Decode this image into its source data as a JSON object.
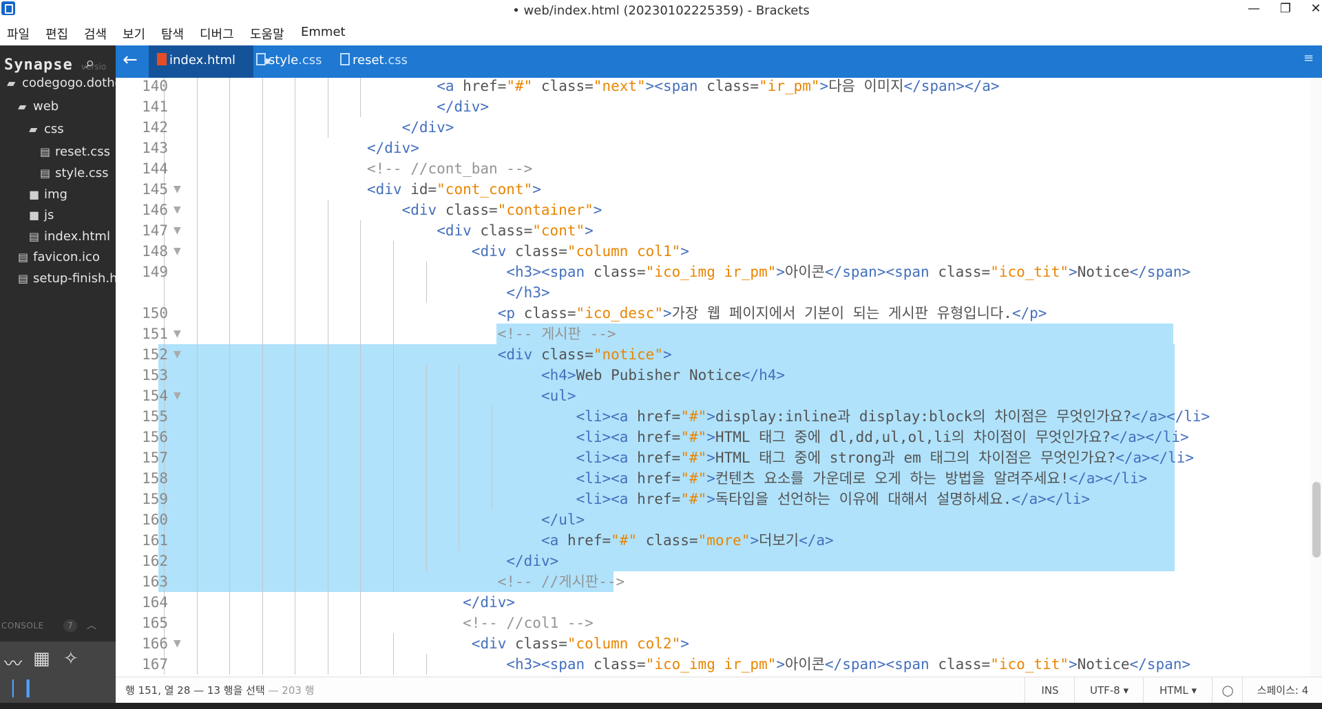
{
  "window": {
    "title": "• web/index.html (20230102225359) - Brackets",
    "controls": {
      "minimize": "—",
      "maximize": "❐",
      "close": "✕"
    }
  },
  "menu": [
    "파일",
    "편집",
    "검색",
    "보기",
    "탐색",
    "디버그",
    "도움말",
    "Emmet"
  ],
  "sidebar": {
    "brand": "Synapse",
    "brand_sub": "versio",
    "search_icon": "search-icon",
    "tree": [
      {
        "label": "codegogo.dotho",
        "type": "folder-open",
        "depth": 0
      },
      {
        "label": "web",
        "type": "folder-open",
        "depth": 1
      },
      {
        "label": "css",
        "type": "folder-open",
        "depth": 2
      },
      {
        "label": "reset.css",
        "type": "file",
        "depth": 3
      },
      {
        "label": "style.css",
        "type": "file",
        "depth": 3
      },
      {
        "label": "img",
        "type": "folder",
        "depth": 2
      },
      {
        "label": "js",
        "type": "folder",
        "depth": 2
      },
      {
        "label": "index.html",
        "type": "file",
        "depth": 2
      },
      {
        "label": "favicon.ico",
        "type": "file",
        "depth": 1
      },
      {
        "label": "setup-finish.h",
        "type": "file",
        "depth": 1
      }
    ],
    "console_label": "CONSOLE",
    "console_count": "7"
  },
  "tabs": [
    {
      "name": "index",
      "ext": ".html",
      "icon": "html5-icon",
      "active": true,
      "dirty": true
    },
    {
      "name": "style",
      "ext": ".css",
      "icon": "css3-icon",
      "active": false,
      "dirty": false
    },
    {
      "name": "reset",
      "ext": ".css",
      "icon": "css3-icon",
      "active": false,
      "dirty": false
    }
  ],
  "colors": {
    "tag": "#446fbd",
    "attr": "#535353",
    "value": "#e88501",
    "text": "#535353",
    "comment": "#949494",
    "selection": "#b0e2fb",
    "tab_bar": "#1f78d1",
    "sidebar": "#2c2c2c"
  },
  "editor": {
    "lines": [
      {
        "n": "140",
        "fold": false,
        "indent": 7,
        "sel": null,
        "tokens": [
          [
            "tag",
            "<a "
          ],
          [
            "attr",
            "href="
          ],
          [
            "val",
            "\"#\""
          ],
          [
            "attr",
            " class="
          ],
          [
            "val",
            "\"next\""
          ],
          [
            "tag",
            "><span "
          ],
          [
            "attr",
            "class="
          ],
          [
            "val",
            "\"ir_pm\""
          ],
          [
            "tag",
            ">"
          ],
          [
            "txt",
            "다음 이미지"
          ],
          [
            "tag",
            "</span></a>"
          ]
        ]
      },
      {
        "n": "141",
        "fold": false,
        "indent": 7,
        "sel": null,
        "tokens": [
          [
            "tag",
            "</div>"
          ]
        ]
      },
      {
        "n": "142",
        "fold": false,
        "indent": 6,
        "sel": null,
        "tokens": [
          [
            "tag",
            "</div>"
          ]
        ]
      },
      {
        "n": "143",
        "fold": false,
        "indent": 5,
        "sel": null,
        "tokens": [
          [
            "tag",
            "</div>"
          ]
        ]
      },
      {
        "n": "144",
        "fold": false,
        "indent": 5,
        "sel": null,
        "tokens": [
          [
            "cmt",
            "<!-- //cont_ban -->"
          ]
        ]
      },
      {
        "n": "145",
        "fold": true,
        "indent": 5,
        "sel": null,
        "tokens": [
          [
            "tag",
            "<div "
          ],
          [
            "attr",
            "id="
          ],
          [
            "val",
            "\"cont_cont\""
          ],
          [
            "tag",
            ">"
          ]
        ]
      },
      {
        "n": "146",
        "fold": true,
        "indent": 6,
        "sel": null,
        "tokens": [
          [
            "tag",
            "<div "
          ],
          [
            "attr",
            "class="
          ],
          [
            "val",
            "\"container\""
          ],
          [
            "tag",
            ">"
          ]
        ]
      },
      {
        "n": "147",
        "fold": true,
        "indent": 7,
        "sel": null,
        "tokens": [
          [
            "tag",
            "<div "
          ],
          [
            "attr",
            "class="
          ],
          [
            "val",
            "\"cont\""
          ],
          [
            "tag",
            ">"
          ]
        ]
      },
      {
        "n": "148",
        "fold": true,
        "indent": 8,
        "sel": null,
        "tokens": [
          [
            "tag",
            "<div "
          ],
          [
            "attr",
            "class="
          ],
          [
            "val",
            "\"column col1\""
          ],
          [
            "tag",
            ">"
          ]
        ]
      },
      {
        "n": "149",
        "fold": false,
        "indent": 9,
        "sel": null,
        "tokens": [
          [
            "tag",
            "<h3><span "
          ],
          [
            "attr",
            "class="
          ],
          [
            "val",
            "\"ico_img ir_pm\""
          ],
          [
            "tag",
            ">"
          ],
          [
            "txt",
            "아이콘"
          ],
          [
            "tag",
            "</span><span "
          ],
          [
            "attr",
            "class="
          ],
          [
            "val",
            "\"ico_tit\""
          ],
          [
            "tag",
            ">"
          ],
          [
            "txt",
            "Notice"
          ],
          [
            "tag",
            "</span>"
          ]
        ]
      },
      {
        "n": "",
        "fold": false,
        "indent": 9,
        "sel": null,
        "tokens": [
          [
            "tag",
            "</h3>"
          ]
        ]
      },
      {
        "n": "150",
        "fold": false,
        "indent": 9,
        "sel": null,
        "offset": -1,
        "tokens": [
          [
            "tag",
            "<p "
          ],
          [
            "attr",
            "class="
          ],
          [
            "val",
            "\"ico_desc\""
          ],
          [
            "tag",
            ">"
          ],
          [
            "txt",
            "가장 웹 페이지에서 기본이 되는 게시판 유형입니다."
          ],
          [
            "tag",
            "</p>"
          ]
        ]
      },
      {
        "n": "151",
        "fold": true,
        "indent": 9,
        "sel": "from-cursor",
        "offset": -1,
        "tokens": [
          [
            "cmt",
            "<!-- 게시판 -->"
          ]
        ]
      },
      {
        "n": "152",
        "fold": true,
        "indent": 9,
        "sel": "full",
        "offset": -1,
        "tokens": [
          [
            "tag",
            "<div "
          ],
          [
            "attr",
            "class="
          ],
          [
            "val",
            "\"notice\""
          ],
          [
            "tag",
            ">"
          ]
        ]
      },
      {
        "n": "153",
        "fold": false,
        "indent": 10,
        "sel": "full",
        "offset": 0,
        "tokens": [
          [
            "tag",
            "<h4>"
          ],
          [
            "txt",
            "Web Pubisher Notice"
          ],
          [
            "tag",
            "</h4>"
          ]
        ]
      },
      {
        "n": "154",
        "fold": true,
        "indent": 10,
        "sel": "full",
        "offset": 0,
        "tokens": [
          [
            "tag",
            "<ul>"
          ]
        ]
      },
      {
        "n": "155",
        "fold": false,
        "indent": 11,
        "sel": "full",
        "offset": 0,
        "tokens": [
          [
            "tag",
            "<li><a "
          ],
          [
            "attr",
            "href="
          ],
          [
            "val",
            "\"#\""
          ],
          [
            "tag",
            ">"
          ],
          [
            "txt",
            "display:inline과 display:block의 차이점은 무엇인가요?"
          ],
          [
            "tag",
            "</a></li>"
          ]
        ]
      },
      {
        "n": "156",
        "fold": false,
        "indent": 11,
        "sel": "full",
        "offset": 0,
        "tokens": [
          [
            "tag",
            "<li><a "
          ],
          [
            "attr",
            "href="
          ],
          [
            "val",
            "\"#\""
          ],
          [
            "tag",
            ">"
          ],
          [
            "txt",
            "HTML 태그 중에 dl,dd,ul,ol,li의 차이점이 무엇인가요?"
          ],
          [
            "tag",
            "</a></li>"
          ]
        ]
      },
      {
        "n": "157",
        "fold": false,
        "indent": 11,
        "sel": "full",
        "offset": 0,
        "tokens": [
          [
            "tag",
            "<li><a "
          ],
          [
            "attr",
            "href="
          ],
          [
            "val",
            "\"#\""
          ],
          [
            "tag",
            ">"
          ],
          [
            "txt",
            "HTML 태그 중에 strong과 em 태그의 차이점은 무엇인가요?"
          ],
          [
            "tag",
            "</a></li>"
          ]
        ]
      },
      {
        "n": "158",
        "fold": false,
        "indent": 11,
        "sel": "full",
        "offset": 0,
        "tokens": [
          [
            "tag",
            "<li><a "
          ],
          [
            "attr",
            "href="
          ],
          [
            "val",
            "\"#\""
          ],
          [
            "tag",
            ">"
          ],
          [
            "txt",
            "컨텐츠 요소를 가운데로 오게 하는 방법을 알려주세요!"
          ],
          [
            "tag",
            "</a></li>"
          ]
        ]
      },
      {
        "n": "159",
        "fold": false,
        "indent": 11,
        "sel": "full",
        "offset": 0,
        "tokens": [
          [
            "tag",
            "<li><a "
          ],
          [
            "attr",
            "href="
          ],
          [
            "val",
            "\"#\""
          ],
          [
            "tag",
            ">"
          ],
          [
            "txt",
            "독타입을 선언하는 이유에 대해서 설명하세요."
          ],
          [
            "tag",
            "</a></li>"
          ]
        ]
      },
      {
        "n": "160",
        "fold": false,
        "indent": 10,
        "sel": "full",
        "offset": 0,
        "tokens": [
          [
            "tag",
            "</ul>"
          ]
        ]
      },
      {
        "n": "161",
        "fold": false,
        "indent": 10,
        "sel": "full",
        "offset": 0,
        "tokens": [
          [
            "tag",
            "<a "
          ],
          [
            "attr",
            "href="
          ],
          [
            "val",
            "\"#\""
          ],
          [
            "attr",
            " class="
          ],
          [
            "val",
            "\"more\""
          ],
          [
            "tag",
            ">"
          ],
          [
            "txt",
            "더보기"
          ],
          [
            "tag",
            "</a>"
          ]
        ]
      },
      {
        "n": "162",
        "fold": false,
        "indent": 9,
        "sel": "full",
        "offset": 0,
        "tokens": [
          [
            "tag",
            "</div>"
          ]
        ]
      },
      {
        "n": "163",
        "fold": false,
        "indent": 9,
        "sel": "to-end",
        "offset": -1,
        "tokens": [
          [
            "cmt",
            "<!-- //게시판-->"
          ]
        ]
      },
      {
        "n": "164",
        "fold": false,
        "indent": 8,
        "sel": null,
        "offset": -1,
        "tokens": [
          [
            "tag",
            "</div>"
          ]
        ]
      },
      {
        "n": "165",
        "fold": false,
        "indent": 8,
        "sel": null,
        "offset": -1,
        "tokens": [
          [
            "cmt",
            "<!-- //col1 -->"
          ]
        ]
      },
      {
        "n": "166",
        "fold": true,
        "indent": 8,
        "sel": null,
        "offset": 0,
        "tokens": [
          [
            "tag",
            "<div "
          ],
          [
            "attr",
            "class="
          ],
          [
            "val",
            "\"column col2\""
          ],
          [
            "tag",
            ">"
          ]
        ]
      },
      {
        "n": "167",
        "fold": false,
        "indent": 9,
        "sel": null,
        "offset": 0,
        "tokens": [
          [
            "tag",
            "<h3><span "
          ],
          [
            "attr",
            "class="
          ],
          [
            "val",
            "\"ico_img ir_pm\""
          ],
          [
            "tag",
            ">"
          ],
          [
            "txt",
            "아이콘"
          ],
          [
            "tag",
            "</span><span "
          ],
          [
            "attr",
            "class="
          ],
          [
            "val",
            "\"ico_tit\""
          ],
          [
            "tag",
            ">"
          ],
          [
            "txt",
            "Notice"
          ],
          [
            "tag",
            "</span>"
          ]
        ]
      }
    ]
  },
  "status": {
    "cursor": "행 151, 열 28 — 13 행을 선택",
    "line_count": "— 203 행",
    "mode": "INS",
    "encoding": "UTF-8 ▾",
    "language": "HTML ▾",
    "indent": "스페이스: 4"
  }
}
